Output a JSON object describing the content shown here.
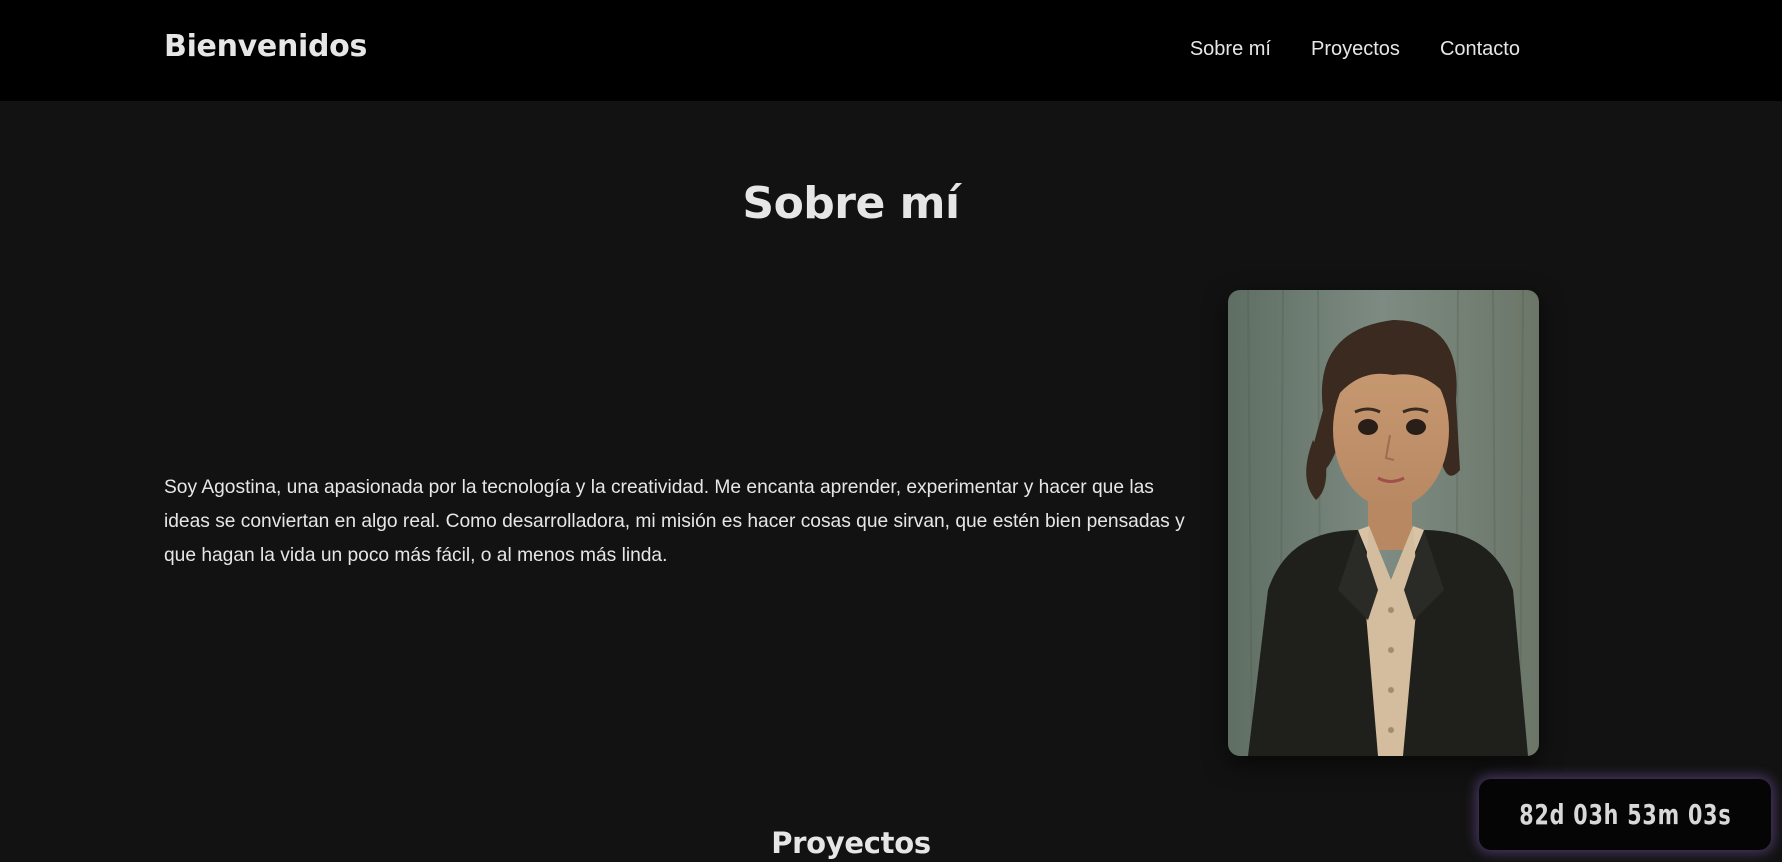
{
  "header": {
    "brand": "Bienvenidos",
    "nav": [
      {
        "label": "Sobre mí"
      },
      {
        "label": "Proyectos"
      },
      {
        "label": "Contacto"
      }
    ]
  },
  "about": {
    "title": "Sobre mí",
    "text": "Soy Agostina, una apasionada por la tecnología y la creatividad. Me encanta aprender, experimentar y hacer que las ideas se conviertan en algo real. Como desarrolladora, mi misión es hacer cosas que sirvan, que estén bien pensadas y que hagan la vida un poco más fácil, o al menos más linda."
  },
  "projects": {
    "title": "Proyectos"
  },
  "countdown": {
    "value": "82d 03h 53m 03s"
  },
  "colors": {
    "header_bg": "#000000",
    "page_bg": "#121212",
    "text": "#e6e6e6",
    "glow": "#8c64c8"
  }
}
